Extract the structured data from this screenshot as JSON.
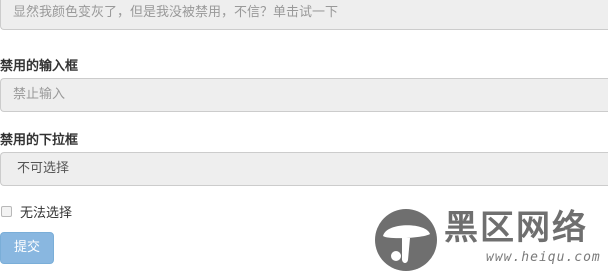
{
  "form": {
    "disabled_text_field": {
      "placeholder": "显然我颜色变灰了，但是我没被禁用，不信？单击试一下"
    },
    "disabled_input": {
      "label": "禁用的输入框",
      "placeholder": "禁止输入"
    },
    "disabled_select": {
      "label": "禁用的下拉框",
      "selected_value": "不可选择"
    },
    "disabled_checkbox": {
      "label": "无法选择",
      "checked": false
    },
    "submit_button": {
      "label": "提交"
    }
  },
  "watermark": {
    "title": "黑区网络",
    "url": "www.heiqu.com"
  },
  "colors": {
    "field_background": "#eeeeee",
    "field_border": "#cccccc",
    "button_background": "#89b7e0",
    "watermark_gray": "#6f6f6f"
  },
  "icons": {
    "watermark_logo": "mushroom-logo-icon"
  }
}
